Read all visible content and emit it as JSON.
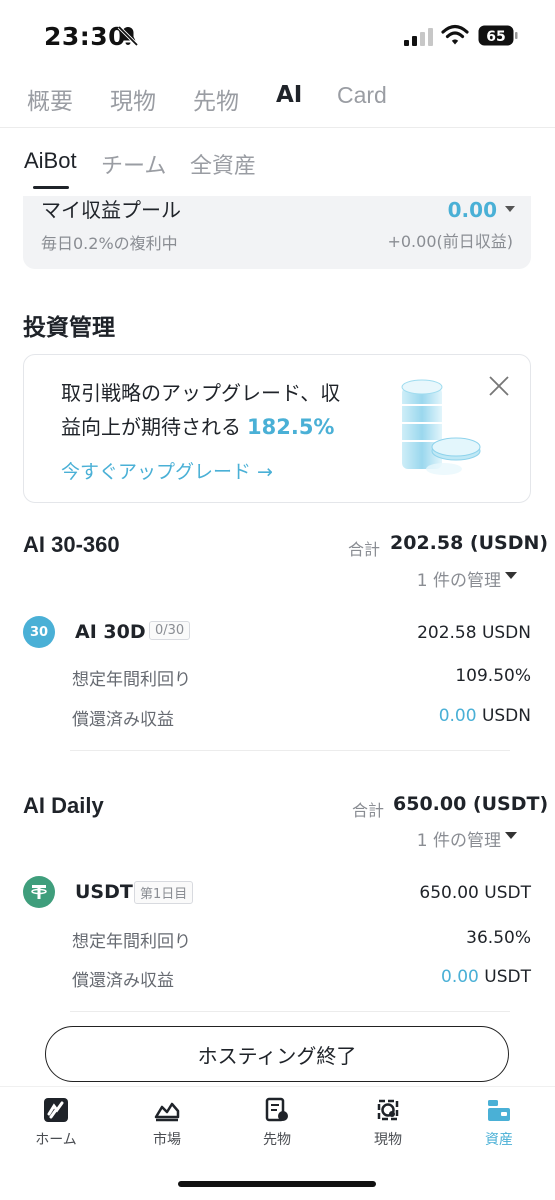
{
  "status": {
    "time": "23:30",
    "battery": "65"
  },
  "top_tabs": [
    "概要",
    "現物",
    "先物",
    "AI",
    "Card"
  ],
  "sub_tabs": [
    "AiBot",
    "チーム",
    "全資産"
  ],
  "pool": {
    "title": "マイ収益プール",
    "subtitle": "毎日0.2%の複利中",
    "value": "0.00",
    "prev": "+0.00(前日収益)"
  },
  "section_title": "投資管理",
  "promo": {
    "line1": "取引戦略のアップグレード、収",
    "line2": "益向上が期待される",
    "percent": "182.5%",
    "link": "今すぐアップグレード →"
  },
  "groups": [
    {
      "title": "AI 30-360",
      "total_label": "合計",
      "total_value": "202.58 (USDN)",
      "manage": "1 件の管理",
      "product": {
        "icon_text": "30",
        "name": "AI 30D",
        "tag": "0/30",
        "amount": "202.58 USDN",
        "rows": [
          {
            "label": "想定年間利回り",
            "value": "109.50%"
          },
          {
            "label": "償還済み収益",
            "value": "0.00",
            "unit": "USDN"
          }
        ]
      }
    },
    {
      "title": "AI Daily",
      "total_label": "合計",
      "total_value": "650.00 (USDT)",
      "manage": "1 件の管理",
      "product": {
        "icon_text": "T",
        "name": "USDT",
        "tag": "第1日目",
        "amount": "650.00 USDT",
        "rows": [
          {
            "label": "想定年間利回り",
            "value": "36.50%"
          },
          {
            "label": "償還済み収益",
            "value": "0.00",
            "unit": "USDT"
          }
        ]
      }
    }
  ],
  "end_button": "ホスティング終了",
  "bottom_nav": [
    {
      "label": "ホーム",
      "icon": "home-logo-icon"
    },
    {
      "label": "市場",
      "icon": "market-icon"
    },
    {
      "label": "先物",
      "icon": "futures-icon"
    },
    {
      "label": "現物",
      "icon": "spot-icon"
    },
    {
      "label": "資産",
      "icon": "assets-icon",
      "active": true
    }
  ],
  "colors": {
    "accent": "#4ab0d6",
    "usdt_green": "#3f9e7c"
  }
}
